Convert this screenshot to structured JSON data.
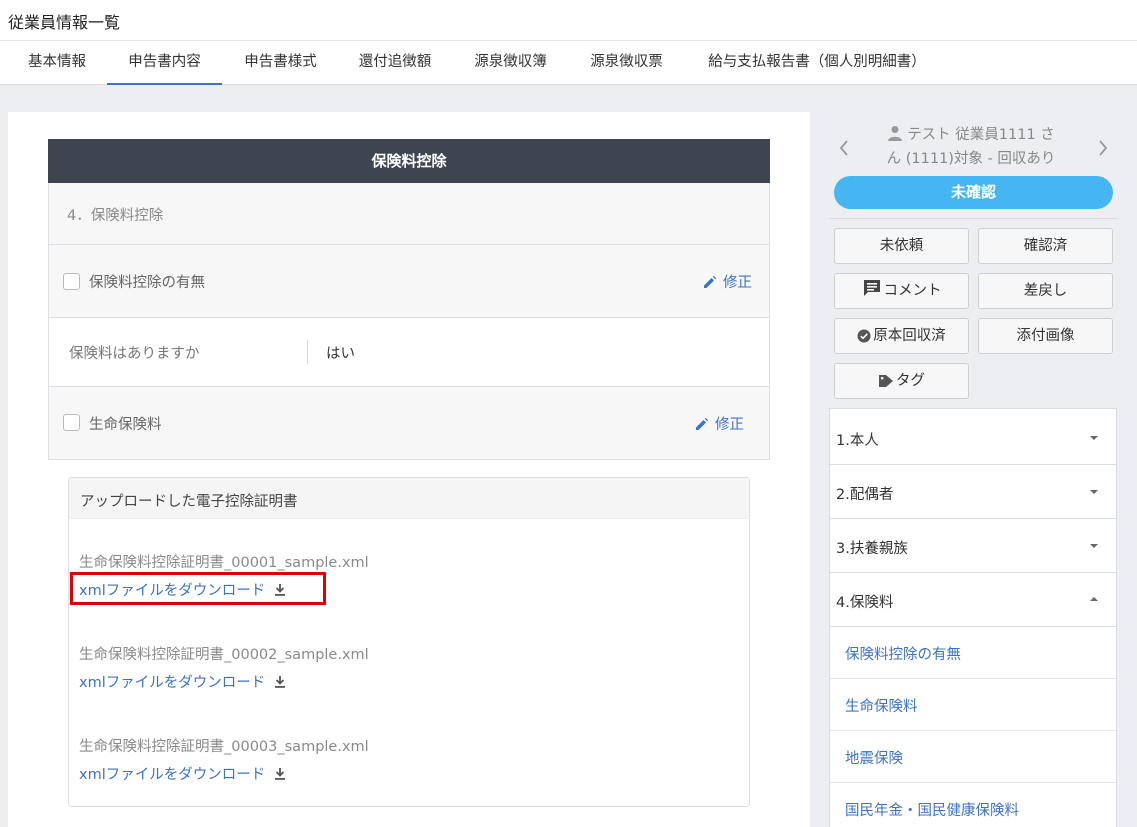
{
  "page": {
    "title": "従業員情報一覧"
  },
  "tabs": [
    {
      "label": "基本情報",
      "active": false
    },
    {
      "label": "申告書内容",
      "active": true
    },
    {
      "label": "申告書様式",
      "active": false
    },
    {
      "label": "還付追徴額",
      "active": false
    },
    {
      "label": "源泉徴収簿",
      "active": false
    },
    {
      "label": "源泉徴収票",
      "active": false
    },
    {
      "label": "給与支払報告書（個人別明細書）",
      "active": false
    }
  ],
  "section": {
    "header": "保険料控除",
    "subtitle": "4．保険料控除",
    "presence_label": "保険料控除の有無",
    "edit_label": "修正",
    "question": "保険料はありますか",
    "answer": "はい",
    "life_insurance_label": "生命保険料"
  },
  "uploads": {
    "title": "アップロードした電子控除証明書",
    "download_label": "xmlファイルをダウンロード",
    "files": [
      "生命保険料控除証明書_00001_sample.xml",
      "生命保険料控除証明書_00002_sample.xml",
      "生命保険料控除証明書_00003_sample.xml"
    ]
  },
  "side": {
    "employee_line1": "テスト 従業員1111 さ",
    "employee_line2": "ん (1111)対象 - 回収あり",
    "status": "未確認",
    "buttons": {
      "not_requested": "未依頼",
      "confirmed": "確認済",
      "comment": "コメント",
      "send_back": "差戻し",
      "original_collected": "原本回収済",
      "attached_image": "添付画像",
      "tag": "タグ"
    }
  },
  "accordion": {
    "items": [
      {
        "label": "1.本人",
        "expanded": false
      },
      {
        "label": "2.配偶者",
        "expanded": false
      },
      {
        "label": "3.扶養親族",
        "expanded": false
      },
      {
        "label": "4.保険料",
        "expanded": true
      }
    ],
    "sub_items": [
      "保険料控除の有無",
      "生命保険料",
      "地震保険",
      "国民年金・国民健康保険料"
    ]
  },
  "colors": {
    "accent": "#3c73c7",
    "header_dark": "#3e4450",
    "status_pill": "#45b6f2",
    "highlight": "#e00000"
  }
}
